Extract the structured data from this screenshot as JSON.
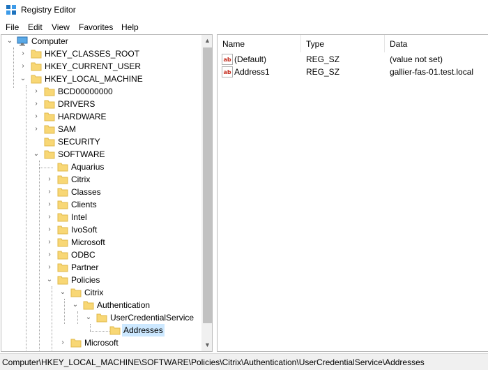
{
  "window": {
    "title": "Registry Editor"
  },
  "menu": [
    "File",
    "Edit",
    "View",
    "Favorites",
    "Help"
  ],
  "tree": {
    "computer": "Computer",
    "hkcr": "HKEY_CLASSES_ROOT",
    "hkcu": "HKEY_CURRENT_USER",
    "hklm": "HKEY_LOCAL_MACHINE",
    "bcd": "BCD00000000",
    "drivers": "DRIVERS",
    "hardware": "HARDWARE",
    "sam": "SAM",
    "security": "SECURITY",
    "software": "SOFTWARE",
    "aquarius": "Aquarius",
    "citrix": "Citrix",
    "classes": "Classes",
    "clients": "Clients",
    "intel": "Intel",
    "ivosoft": "IvoSoft",
    "microsoft": "Microsoft",
    "odbc": "ODBC",
    "partner": "Partner",
    "policies": "Policies",
    "policies_citrix": "Citrix",
    "authentication": "Authentication",
    "ucs": "UserCredentialService",
    "addresses": "Addresses",
    "policies_microsoft": "Microsoft"
  },
  "list": {
    "columns": [
      "Name",
      "Type",
      "Data"
    ],
    "rows": [
      {
        "name": "(Default)",
        "type": "REG_SZ",
        "data": "(value not set)"
      },
      {
        "name": "Address1",
        "type": "REG_SZ",
        "data": "gallier-fas-01.test.local"
      }
    ]
  },
  "status": {
    "path": "Computer\\HKEY_LOCAL_MACHINE\\SOFTWARE\\Policies\\Citrix\\Authentication\\UserCredentialService\\Addresses"
  },
  "colors": {
    "selection": "#cce8ff",
    "folder": "#f8d775",
    "folder_dark": "#e0b94a",
    "ab_red": "#c42b1c"
  }
}
